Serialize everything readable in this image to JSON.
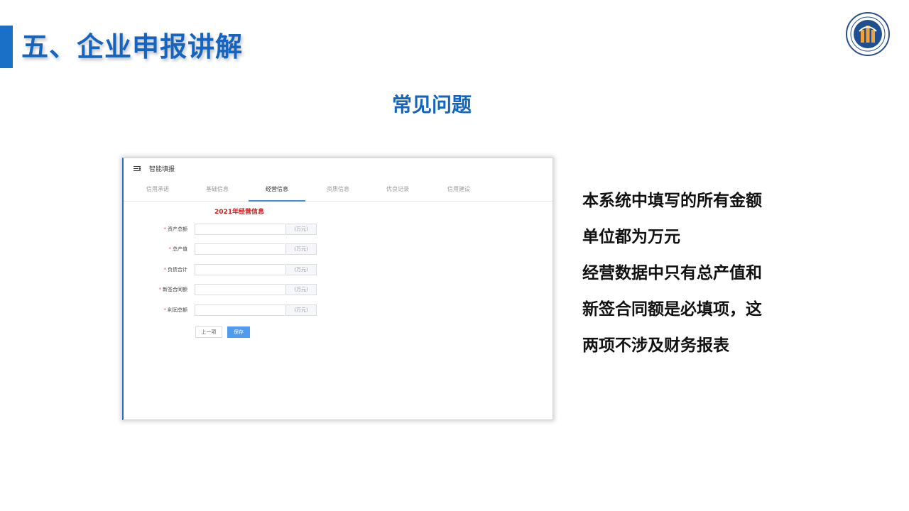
{
  "slide": {
    "title": "五、企业申报讲解",
    "subtitle": "常见问题",
    "accent_color": "#1565c0"
  },
  "screenshot": {
    "app_title": "智能填报",
    "tabs": [
      {
        "label": "信用承诺",
        "active": false
      },
      {
        "label": "基础信息",
        "active": false
      },
      {
        "label": "经营信息",
        "active": true
      },
      {
        "label": "资质信息",
        "active": false
      },
      {
        "label": "优良记录",
        "active": false
      },
      {
        "label": "信用建设",
        "active": false
      }
    ],
    "form_title": "2021年经营信息",
    "required_mark": "*",
    "fields": [
      {
        "label": "资产总额",
        "value": "",
        "unit": "(万元)"
      },
      {
        "label": "总产值",
        "value": "",
        "unit": "(万元)"
      },
      {
        "label": "负债合计",
        "value": "",
        "unit": "(万元)"
      },
      {
        "label": "新签合同额",
        "value": "",
        "unit": "(万元)"
      },
      {
        "label": "利润总额",
        "value": "",
        "unit": "(万元)"
      }
    ],
    "prev_button": "上一项",
    "save_button": "保存"
  },
  "notes": [
    "本系统中填写的所有金额",
    "单位都为万元",
    "经营数据中只有总产值和",
    "新签合同额是必填项，这",
    "两项不涉及财务报表"
  ]
}
